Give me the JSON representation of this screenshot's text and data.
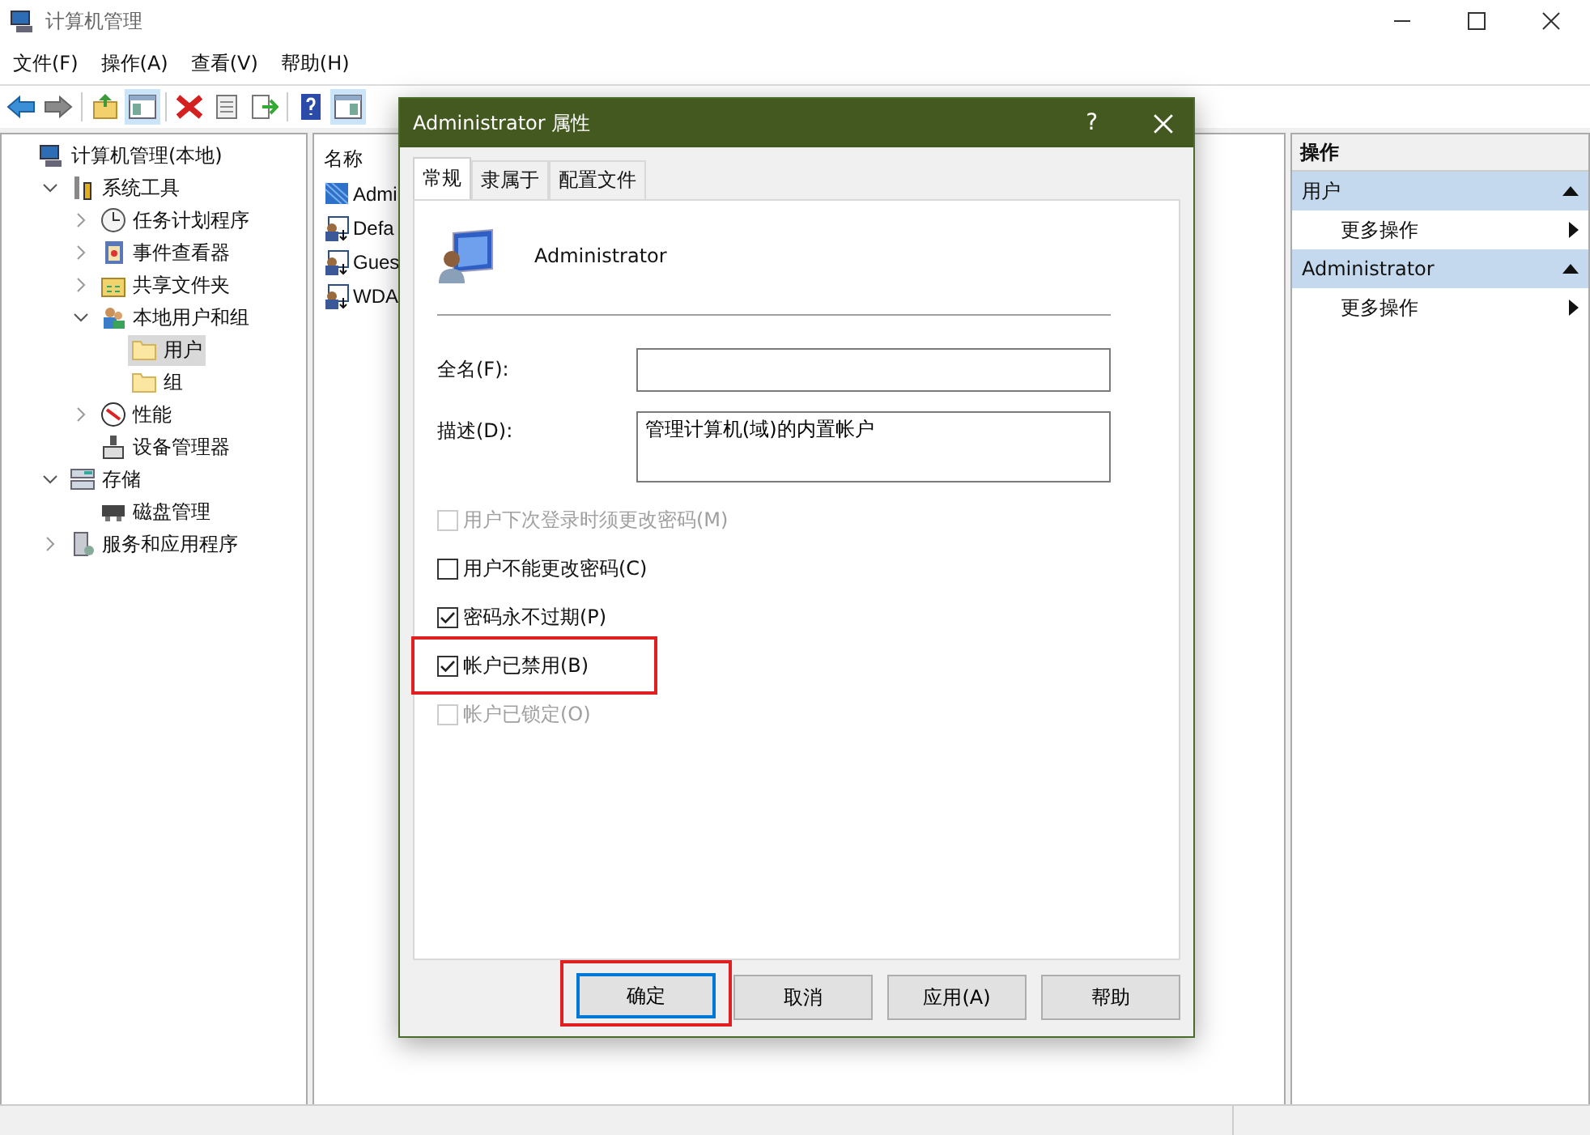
{
  "window": {
    "title": "计算机管理"
  },
  "menu": [
    "文件(F)",
    "操作(A)",
    "查看(V)",
    "帮助(H)"
  ],
  "toolbar": [
    {
      "kind": "back",
      "selected": false
    },
    {
      "kind": "forward",
      "selected": false
    },
    {
      "kind": "up",
      "selected": false
    },
    {
      "kind": "tree",
      "selected": true
    },
    {
      "kind": "delete",
      "selected": false
    },
    {
      "kind": "properties",
      "selected": false
    },
    {
      "kind": "export",
      "selected": false
    },
    {
      "kind": "help",
      "selected": false
    },
    {
      "kind": "actions",
      "selected": true
    }
  ],
  "tree": [
    {
      "label": "计算机管理(本地)",
      "selected": false,
      "children": [
        {
          "label": "系统工具",
          "expanded": true,
          "selected": false,
          "children": [
            {
              "label": "任务计划程序",
              "expanded": false,
              "selected": false
            },
            {
              "label": "事件查看器",
              "expanded": false,
              "selected": false
            },
            {
              "label": "共享文件夹",
              "expanded": false,
              "selected": false
            },
            {
              "label": "本地用户和组",
              "expanded": true,
              "selected": false,
              "children": [
                {
                  "label": "用户",
                  "selected": true
                },
                {
                  "label": "组",
                  "selected": false
                }
              ]
            },
            {
              "label": "性能",
              "expanded": false,
              "selected": false
            },
            {
              "label": "设备管理器",
              "selected": false
            }
          ]
        },
        {
          "label": "存储",
          "expanded": true,
          "selected": false,
          "children": [
            {
              "label": "磁盘管理",
              "selected": false
            }
          ]
        },
        {
          "label": "服务和应用程序",
          "expanded": false,
          "selected": false
        }
      ]
    }
  ],
  "list": {
    "column": "名称",
    "rows": [
      {
        "name": "Admi",
        "kind": "admin"
      },
      {
        "name": "Defa",
        "kind": "user"
      },
      {
        "name": "Gues",
        "kind": "user"
      },
      {
        "name": "WDA",
        "kind": "user"
      }
    ]
  },
  "actions": {
    "title": "操作",
    "sections": [
      {
        "title": "用户",
        "expanded": true,
        "items": [
          "更多操作"
        ]
      },
      {
        "title": "Administrator",
        "expanded": true,
        "items": [
          "更多操作"
        ]
      }
    ]
  },
  "dialog": {
    "title": "Administrator 属性",
    "help": "?",
    "tabs": [
      {
        "label": "常规",
        "selected": true
      },
      {
        "label": "隶属于",
        "selected": false
      },
      {
        "label": "配置文件",
        "selected": false
      }
    ],
    "user_name": "Administrator",
    "fields": [
      {
        "label": "全名(F):",
        "multiline": false
      },
      {
        "label": "描述(D):",
        "value": "管理计算机(域)的内置帐户",
        "multiline": true
      }
    ],
    "checkboxes": [
      {
        "label": "用户下次登录时须更改密码(M)",
        "checked": false,
        "disabled": true,
        "highlighted": false
      },
      {
        "label": "用户不能更改密码(C)",
        "checked": false,
        "disabled": false,
        "highlighted": false
      },
      {
        "label": "密码永不过期(P)",
        "checked": true,
        "disabled": false,
        "highlighted": false
      },
      {
        "label": "帐户已禁用(B)",
        "checked": true,
        "disabled": false,
        "highlighted": true
      },
      {
        "label": "帐户已锁定(O)",
        "checked": false,
        "disabled": true,
        "highlighted": false
      }
    ],
    "buttons": [
      {
        "label": "确定",
        "default": true,
        "highlighted": true
      },
      {
        "label": "取消",
        "default": false,
        "highlighted": false
      },
      {
        "label": "应用(A)",
        "default": false,
        "highlighted": false
      },
      {
        "label": "帮助",
        "default": false,
        "highlighted": false
      }
    ]
  }
}
